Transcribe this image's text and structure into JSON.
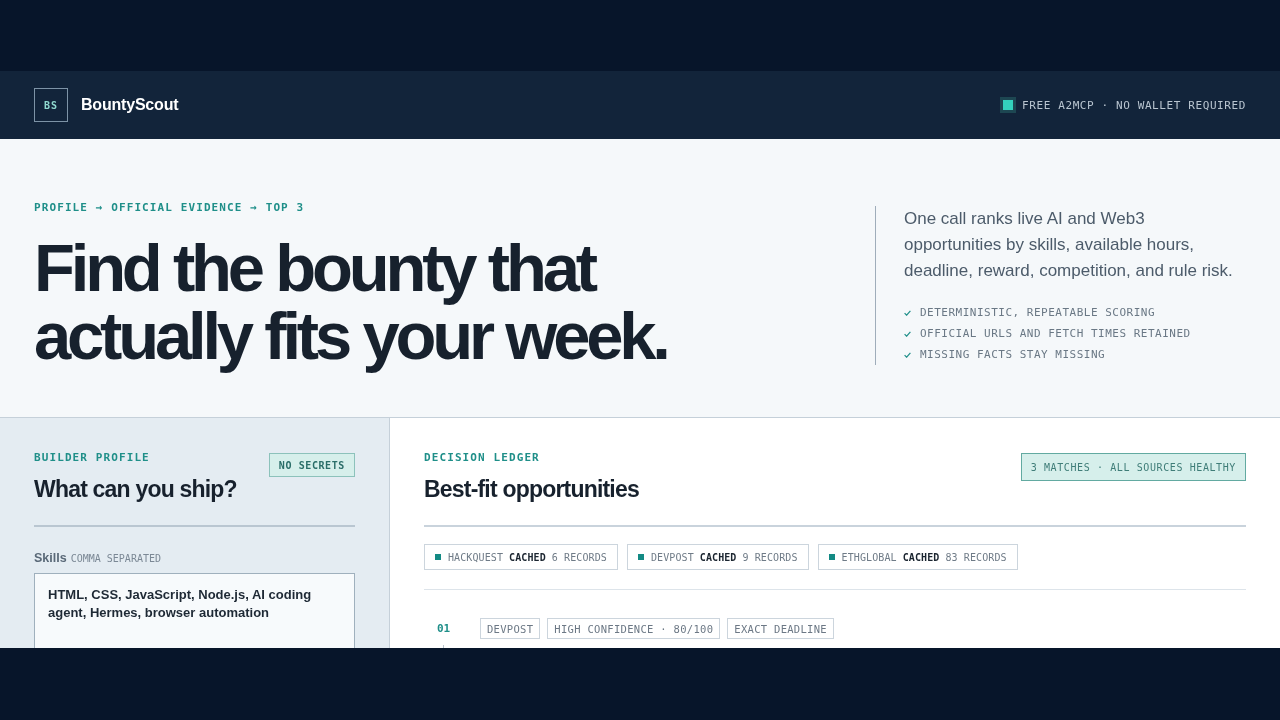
{
  "header": {
    "logo": "BS",
    "brand": "BountyScout",
    "status": "FREE A2MCP · NO WALLET REQUIRED"
  },
  "hero": {
    "eyebrow": "PROFILE → OFFICIAL EVIDENCE → TOP 3",
    "headline": "Find the bounty that actually fits your week.",
    "description": "One call ranks live AI and Web3 opportunities by skills, available hours, deadline, reward, competition, and rule risk.",
    "checklist": [
      "DETERMINISTIC, REPEATABLE SCORING",
      "OFFICIAL URLS AND FETCH TIMES RETAINED",
      "MISSING FACTS STAY MISSING"
    ]
  },
  "profile": {
    "eyebrow": "BUILDER PROFILE",
    "title": "What can you ship?",
    "badge": "NO SECRETS",
    "fields": [
      {
        "label": "Skills",
        "hint": "COMMA SEPARATED",
        "value": "HTML, CSS, JavaScript, Node.js, AI coding agent, Hermes, browser automation"
      }
    ]
  },
  "ledger": {
    "eyebrow": "DECISION LEDGER",
    "title": "Best-fit opportunities",
    "badge": "3 MATCHES · ALL SOURCES HEALTHY",
    "sources": [
      {
        "name": "HACKQUEST",
        "status": "CACHED",
        "records": "6 RECORDS"
      },
      {
        "name": "DEVPOST",
        "status": "CACHED",
        "records": "9 RECORDS"
      },
      {
        "name": "ETHGLOBAL",
        "status": "CACHED",
        "records": "83 RECORDS"
      }
    ],
    "results": [
      {
        "rank": "01",
        "tags": [
          "DEVPOST",
          "HIGH CONFIDENCE · 80/100",
          "EXACT DEADLINE"
        ]
      }
    ]
  }
}
